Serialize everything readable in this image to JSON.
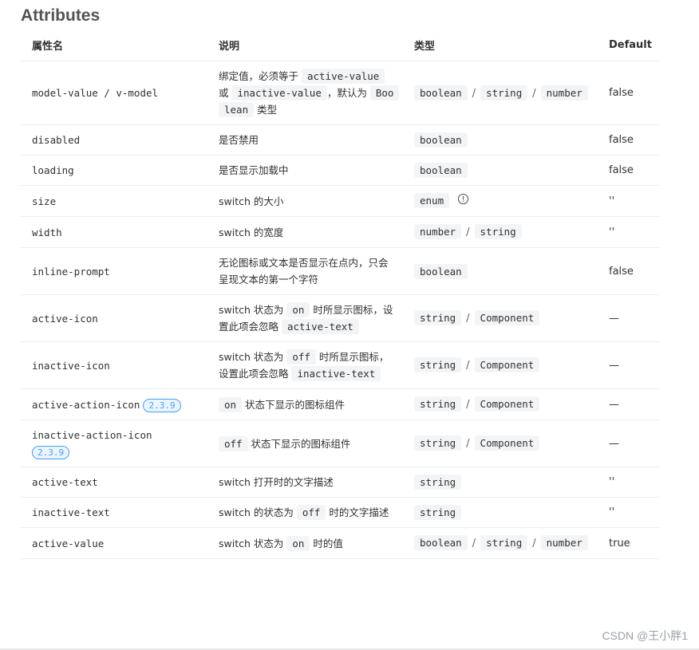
{
  "title": "Attributes",
  "headers": {
    "name": "属性名",
    "desc": "说明",
    "type": "类型",
    "default": "Default"
  },
  "rows": [
    {
      "name": "model-value / v-model",
      "desc": [
        {
          "t": "绑定值，必须等于 "
        },
        {
          "c": "active-value"
        },
        {
          "t": " 或 "
        },
        {
          "c": "inactive-value"
        },
        {
          "t": "，默认为 "
        },
        {
          "c": "Boolean"
        },
        {
          "t": " 类型"
        }
      ],
      "types": [
        "boolean",
        "string",
        "number"
      ],
      "default": "false"
    },
    {
      "name": "disabled",
      "desc": [
        {
          "t": "是否禁用"
        }
      ],
      "types": [
        "boolean"
      ],
      "default": "false"
    },
    {
      "name": "loading",
      "desc": [
        {
          "t": "是否显示加载中"
        }
      ],
      "types": [
        "boolean"
      ],
      "default": "false"
    },
    {
      "name": "size",
      "desc": [
        {
          "t": "switch 的大小"
        }
      ],
      "types": [
        "enum"
      ],
      "info": true,
      "default": "''"
    },
    {
      "name": "width",
      "desc": [
        {
          "t": "switch 的宽度"
        }
      ],
      "types": [
        "number",
        "string"
      ],
      "default": "''"
    },
    {
      "name": "inline-prompt",
      "desc": [
        {
          "t": "无论图标或文本是否显示在点内，只会呈现文本的第一个字符"
        }
      ],
      "types": [
        "boolean"
      ],
      "default": "false"
    },
    {
      "name": "active-icon",
      "desc": [
        {
          "t": "switch 状态为 "
        },
        {
          "c": "on"
        },
        {
          "t": " 时所显示图标，设置此项会忽略 "
        },
        {
          "c": "active-text"
        }
      ],
      "types": [
        "string",
        "Component"
      ],
      "default": "—"
    },
    {
      "name": "inactive-icon",
      "desc": [
        {
          "t": "switch 状态为 "
        },
        {
          "c": "off"
        },
        {
          "t": " 时所显示图标，设置此项会忽略 "
        },
        {
          "c": "inactive-text"
        }
      ],
      "types": [
        "string",
        "Component"
      ],
      "default": "—"
    },
    {
      "name": "active-action-icon",
      "badge": "2.3.9",
      "desc": [
        {
          "c": "on"
        },
        {
          "t": " 状态下显示的图标组件"
        }
      ],
      "types": [
        "string",
        "Component"
      ],
      "default": "—"
    },
    {
      "name": "inactive-action-icon",
      "badge": "2.3.9",
      "badge_below": true,
      "desc": [
        {
          "c": "off"
        },
        {
          "t": " 状态下显示的图标组件"
        }
      ],
      "types": [
        "string",
        "Component"
      ],
      "default": "—"
    },
    {
      "name": "active-text",
      "desc": [
        {
          "t": "switch 打开时的文字描述"
        }
      ],
      "types": [
        "string"
      ],
      "default": "''"
    },
    {
      "name": "inactive-text",
      "desc": [
        {
          "t": "switch 的状态为 "
        },
        {
          "c": "off"
        },
        {
          "t": " 时的文字描述"
        }
      ],
      "types": [
        "string"
      ],
      "default": "''"
    },
    {
      "name": "active-value",
      "desc": [
        {
          "t": "switch 状态为 "
        },
        {
          "c": "on"
        },
        {
          "t": " 时的值"
        }
      ],
      "types": [
        "boolean",
        "string",
        "number"
      ],
      "default": "true"
    }
  ],
  "type_separator": "/",
  "watermark": "CSDN @王小胖1",
  "icons": {
    "info": "info-circle-icon"
  },
  "colors": {
    "badge": "#409eff",
    "code_bg": "#f3f4f6",
    "border": "#ebeef5"
  }
}
